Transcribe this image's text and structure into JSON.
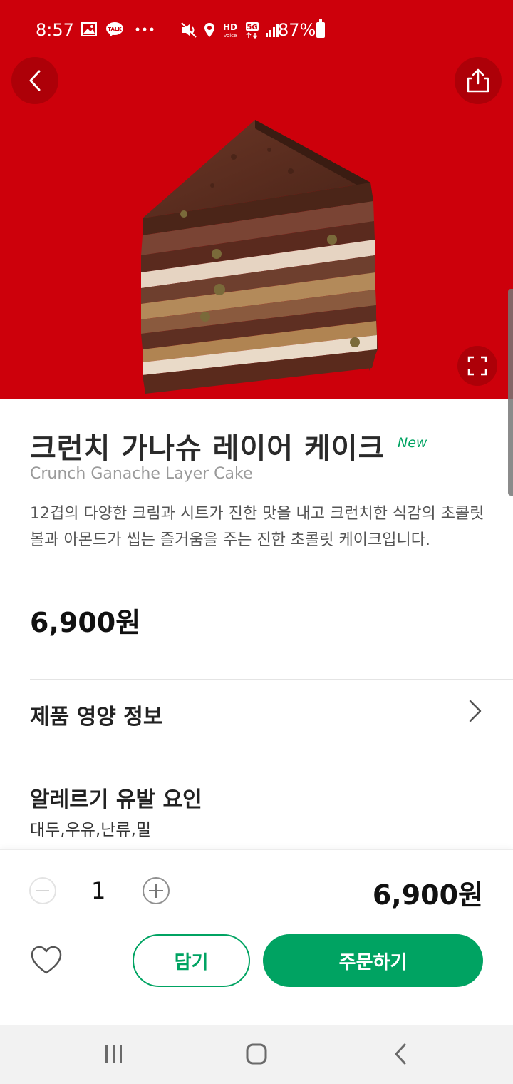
{
  "status_bar": {
    "time": "8:57",
    "battery_text": "87%",
    "icons": [
      "gallery-icon",
      "kakaotalk-icon",
      "more-dots-icon",
      "mute-icon",
      "location-icon",
      "hd-voice-icon",
      "5g-icon",
      "signal-icon",
      "battery-icon"
    ],
    "talk_label": "TALK",
    "hd_label": "HD",
    "voice_label": "Voice",
    "net_label": "5G",
    "battery_level": 0.87
  },
  "hero": {
    "background_color": "#cd000b",
    "back_icon": "chevron-left-icon",
    "share_icon": "share-icon",
    "zoom_icon": "fullscreen-icon"
  },
  "product": {
    "name_ko": "크런치 가나슈 레이어 케이크",
    "badge": "New",
    "name_en": "Crunch Ganache Layer Cake",
    "description": "12겹의 다양한 크림과 시트가 진한 맛을 내고 크런치한 식감의 초콜릿 볼과 아몬드가 씹는 즐거움을 주는 진한 초콜릿 케이크입니다.",
    "price": "6,900원"
  },
  "nutrition": {
    "label": "제품 영양 정보",
    "icon": "chevron-right-icon"
  },
  "allergy": {
    "label": "알레르기 유발 요인",
    "value": "대두,우유,난류,밀"
  },
  "order": {
    "quantity": "1",
    "total": "6,900원",
    "cart_label": "담기",
    "order_label": "주문하기",
    "accent_color": "#00a362"
  },
  "nav_bar": {
    "items": [
      "recent-apps-icon",
      "home-icon",
      "back-icon"
    ]
  }
}
